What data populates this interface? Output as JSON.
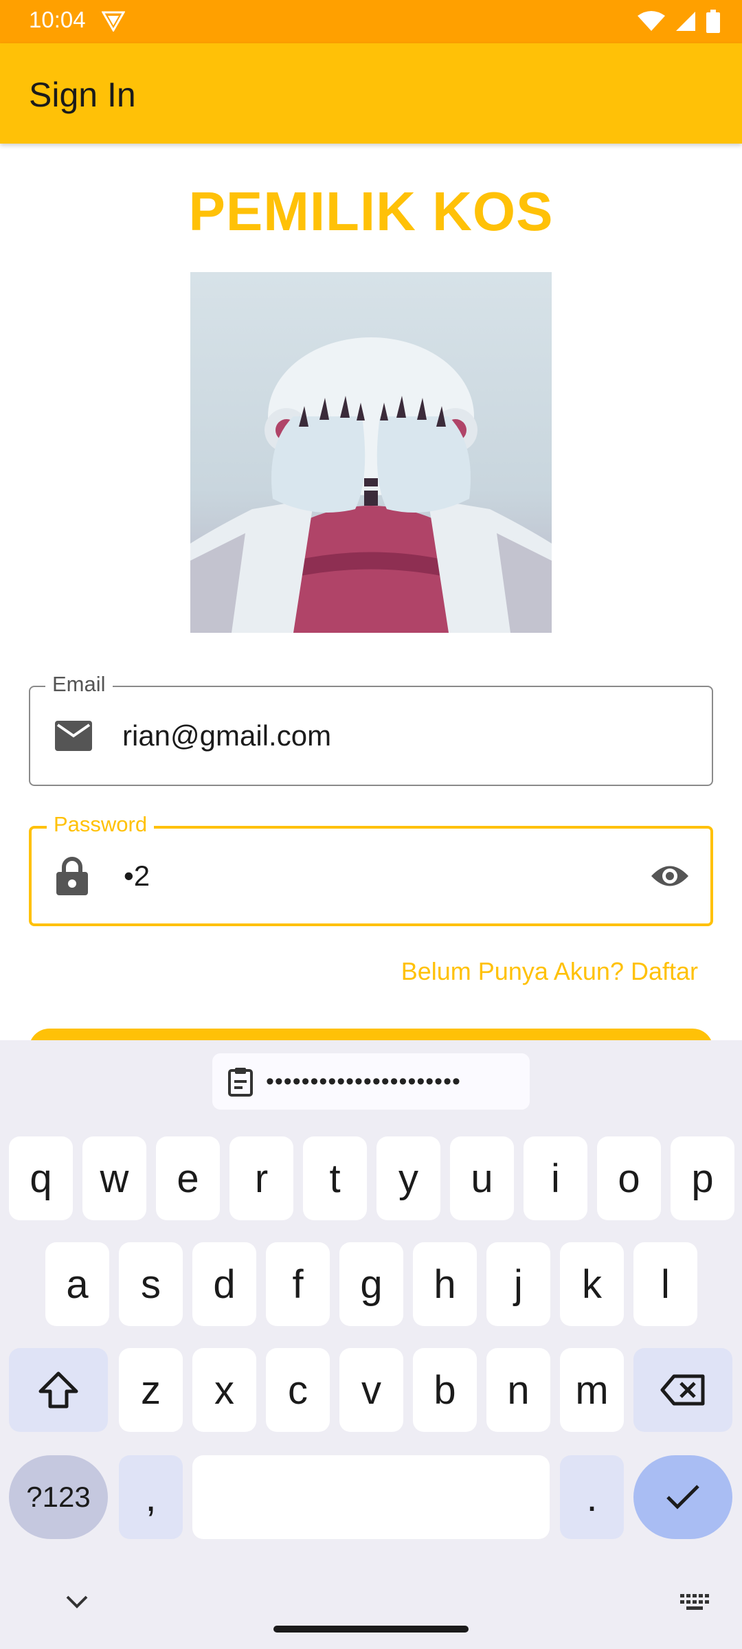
{
  "status_bar": {
    "time": "10:04"
  },
  "app_bar": {
    "title": "Sign In"
  },
  "main": {
    "heading": "PEMILIK KOS",
    "email": {
      "label": "Email",
      "value": "rian@gmail.com"
    },
    "password": {
      "label": "Password",
      "value": "•2"
    },
    "signup_link": "Belum Punya Akun? Daftar"
  },
  "keyboard": {
    "clipboard_suggestion": "••••••••••••••••••••••",
    "row1": [
      "q",
      "w",
      "e",
      "r",
      "t",
      "y",
      "u",
      "i",
      "o",
      "p"
    ],
    "row2": [
      "a",
      "s",
      "d",
      "f",
      "g",
      "h",
      "j",
      "k",
      "l"
    ],
    "row3": [
      "z",
      "x",
      "c",
      "v",
      "b",
      "n",
      "m"
    ],
    "symbols_key": "?123",
    "comma_key": ",",
    "period_key": "."
  },
  "colors": {
    "accent": "#FFC107",
    "status_bar": "#FFA000",
    "keyboard_bg": "#eeedf4"
  }
}
